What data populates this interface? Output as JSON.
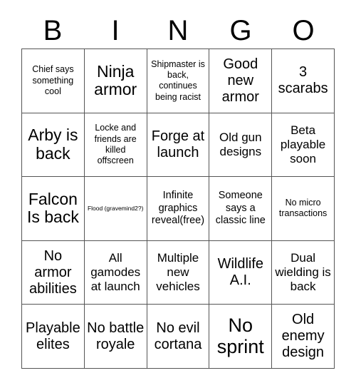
{
  "header": {
    "letters": [
      "B",
      "I",
      "N",
      "G",
      "O"
    ]
  },
  "colors": {
    "background": "#ffffff",
    "text": "#000000",
    "grid_line": "#555555"
  },
  "grid": {
    "rows": [
      [
        {
          "text": "Chief says something cool",
          "size": "s"
        },
        {
          "text": "Ninja armor",
          "size": "xxl"
        },
        {
          "text": "Shipmaster is back, continues being racist",
          "size": "s"
        },
        {
          "text": "Good new armor",
          "size": "xl"
        },
        {
          "text": "3 scarabs",
          "size": "xl"
        }
      ],
      [
        {
          "text": "Arby is back",
          "size": "xxl"
        },
        {
          "text": "Locke and friends are killed offscreen",
          "size": "s"
        },
        {
          "text": "Forge at launch",
          "size": "xl"
        },
        {
          "text": "Old gun designs",
          "size": "l"
        },
        {
          "text": "Beta playable soon",
          "size": "l"
        }
      ],
      [
        {
          "text": "Falcon Is back",
          "size": "xxl"
        },
        {
          "text": "Flood (gravemind2?)",
          "size": "xs"
        },
        {
          "text": "Infinite graphics reveal(free)",
          "size": "m"
        },
        {
          "text": "Someone says a classic line",
          "size": "m"
        },
        {
          "text": "No micro transactions",
          "size": "s"
        }
      ],
      [
        {
          "text": "No armor abilities",
          "size": "xl"
        },
        {
          "text": "All gamodes at launch",
          "size": "l"
        },
        {
          "text": "Multiple new vehicles",
          "size": "l"
        },
        {
          "text": "Wildlife A.I.",
          "size": "xl"
        },
        {
          "text": "Dual wielding is back",
          "size": "l"
        }
      ],
      [
        {
          "text": "Playable elites",
          "size": "xl"
        },
        {
          "text": "No battle royale",
          "size": "xl"
        },
        {
          "text": "No evil cortana",
          "size": "xl"
        },
        {
          "text": "No sprint",
          "size": "huge"
        },
        {
          "text": "Old enemy design",
          "size": "xl"
        }
      ]
    ]
  }
}
